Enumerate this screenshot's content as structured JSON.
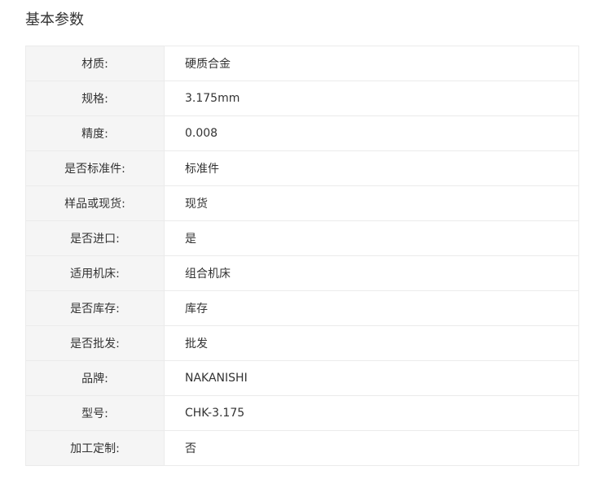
{
  "section": {
    "title": "基本参数"
  },
  "params": [
    {
      "label": "材质:",
      "value": "硬质合金"
    },
    {
      "label": "规格:",
      "value": "3.175mm"
    },
    {
      "label": "精度:",
      "value": "0.008"
    },
    {
      "label": "是否标准件:",
      "value": "标准件"
    },
    {
      "label": "样品或现货:",
      "value": "现货"
    },
    {
      "label": "是否进口:",
      "value": "是"
    },
    {
      "label": "适用机床:",
      "value": "组合机床"
    },
    {
      "label": "是否库存:",
      "value": "库存"
    },
    {
      "label": "是否批发:",
      "value": "批发"
    },
    {
      "label": "品牌:",
      "value": "NAKANISHI"
    },
    {
      "label": "型号:",
      "value": "CHK-3.175"
    },
    {
      "label": "加工定制:",
      "value": "否"
    }
  ]
}
